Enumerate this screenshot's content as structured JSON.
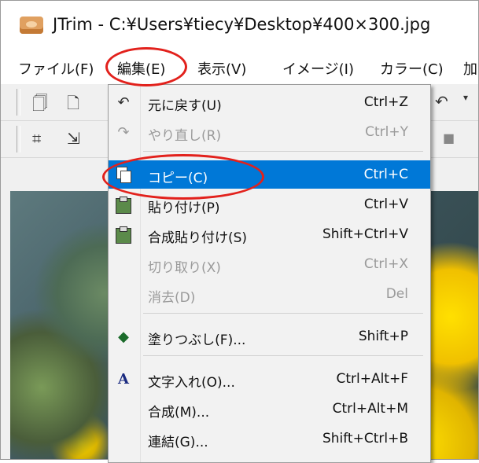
{
  "window": {
    "title": "JTrim - C:¥Users¥tiecy¥Desktop¥400×300.jpg"
  },
  "menubar": [
    {
      "label": "ファイル(F)"
    },
    {
      "label": "編集(E)"
    },
    {
      "label": "表示(V)"
    },
    {
      "label": "イメージ(I)"
    },
    {
      "label": "カラー(C)"
    },
    {
      "label": "加"
    }
  ],
  "edit_menu": {
    "items": [
      {
        "icon": "undo-icon",
        "label": "元に戻す(U)",
        "shortcut": "Ctrl+Z",
        "enabled": true
      },
      {
        "icon": "redo-icon",
        "label": "やり直し(R)",
        "shortcut": "Ctrl+Y",
        "enabled": false
      },
      {
        "icon": "copy-icon",
        "label": "コピー(C)",
        "shortcut": "Ctrl+C",
        "enabled": true,
        "selected": true
      },
      {
        "icon": "paste-icon",
        "label": "貼り付け(P)",
        "shortcut": "Ctrl+V",
        "enabled": true
      },
      {
        "icon": "paste-merge-icon",
        "label": "合成貼り付け(S)",
        "shortcut": "Shift+Ctrl+V",
        "enabled": true
      },
      {
        "icon": "cut-icon",
        "label": "切り取り(X)",
        "shortcut": "Ctrl+X",
        "enabled": false
      },
      {
        "icon": "erase-icon",
        "label": "消去(D)",
        "shortcut": "Del",
        "enabled": false
      },
      {
        "icon": "fill-icon",
        "label": "塗りつぶし(F)...",
        "shortcut": "Shift+P",
        "enabled": true
      },
      {
        "icon": "text-icon",
        "label": "文字入れ(O)...",
        "shortcut": "Ctrl+Alt+F",
        "enabled": true
      },
      {
        "icon": "",
        "label": "合成(M)...",
        "shortcut": "Ctrl+Alt+M",
        "enabled": true
      },
      {
        "icon": "",
        "label": "連結(G)...",
        "shortcut": "Shift+Ctrl+B",
        "enabled": true
      }
    ]
  },
  "colors": {
    "highlight": "#0078d7",
    "annotation": "#e2211c",
    "disabled": "#9a9a9a"
  }
}
